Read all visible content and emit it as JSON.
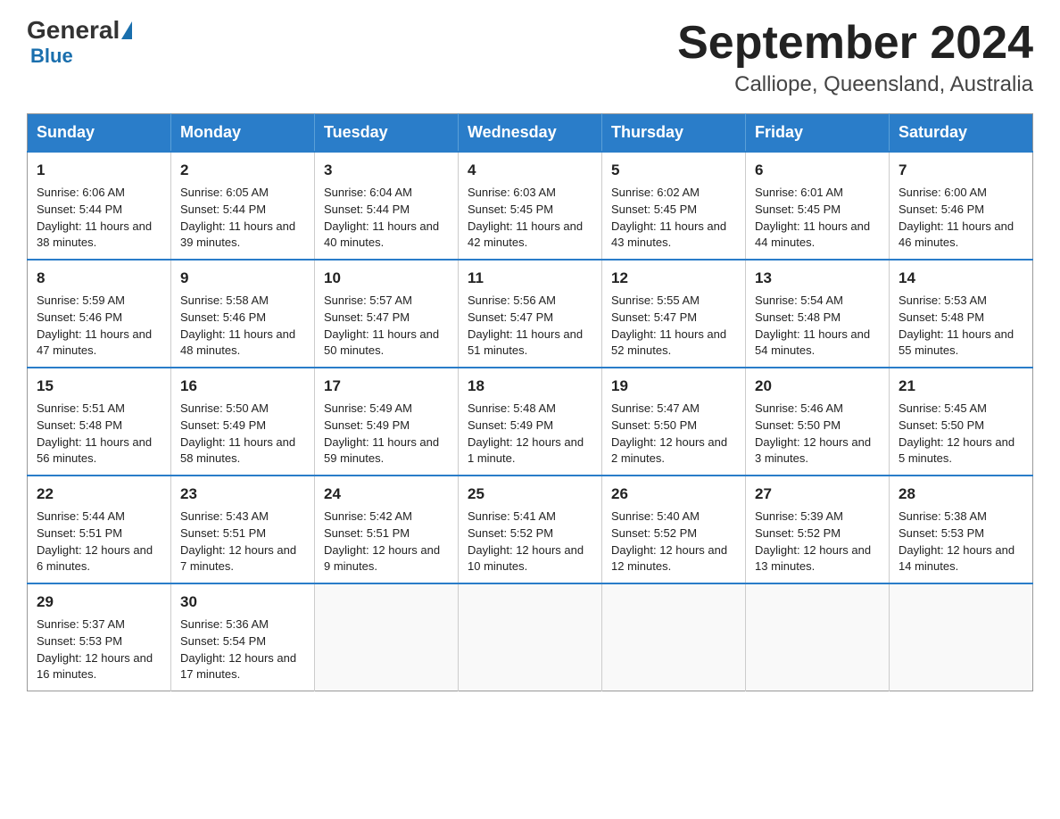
{
  "header": {
    "logo_general": "General",
    "logo_blue": "Blue",
    "month_title": "September 2024",
    "location": "Calliope, Queensland, Australia"
  },
  "weekdays": [
    "Sunday",
    "Monday",
    "Tuesday",
    "Wednesday",
    "Thursday",
    "Friday",
    "Saturday"
  ],
  "weeks": [
    [
      {
        "day": "1",
        "sunrise": "6:06 AM",
        "sunset": "5:44 PM",
        "daylight": "11 hours and 38 minutes."
      },
      {
        "day": "2",
        "sunrise": "6:05 AM",
        "sunset": "5:44 PM",
        "daylight": "11 hours and 39 minutes."
      },
      {
        "day": "3",
        "sunrise": "6:04 AM",
        "sunset": "5:44 PM",
        "daylight": "11 hours and 40 minutes."
      },
      {
        "day": "4",
        "sunrise": "6:03 AM",
        "sunset": "5:45 PM",
        "daylight": "11 hours and 42 minutes."
      },
      {
        "day": "5",
        "sunrise": "6:02 AM",
        "sunset": "5:45 PM",
        "daylight": "11 hours and 43 minutes."
      },
      {
        "day": "6",
        "sunrise": "6:01 AM",
        "sunset": "5:45 PM",
        "daylight": "11 hours and 44 minutes."
      },
      {
        "day": "7",
        "sunrise": "6:00 AM",
        "sunset": "5:46 PM",
        "daylight": "11 hours and 46 minutes."
      }
    ],
    [
      {
        "day": "8",
        "sunrise": "5:59 AM",
        "sunset": "5:46 PM",
        "daylight": "11 hours and 47 minutes."
      },
      {
        "day": "9",
        "sunrise": "5:58 AM",
        "sunset": "5:46 PM",
        "daylight": "11 hours and 48 minutes."
      },
      {
        "day": "10",
        "sunrise": "5:57 AM",
        "sunset": "5:47 PM",
        "daylight": "11 hours and 50 minutes."
      },
      {
        "day": "11",
        "sunrise": "5:56 AM",
        "sunset": "5:47 PM",
        "daylight": "11 hours and 51 minutes."
      },
      {
        "day": "12",
        "sunrise": "5:55 AM",
        "sunset": "5:47 PM",
        "daylight": "11 hours and 52 minutes."
      },
      {
        "day": "13",
        "sunrise": "5:54 AM",
        "sunset": "5:48 PM",
        "daylight": "11 hours and 54 minutes."
      },
      {
        "day": "14",
        "sunrise": "5:53 AM",
        "sunset": "5:48 PM",
        "daylight": "11 hours and 55 minutes."
      }
    ],
    [
      {
        "day": "15",
        "sunrise": "5:51 AM",
        "sunset": "5:48 PM",
        "daylight": "11 hours and 56 minutes."
      },
      {
        "day": "16",
        "sunrise": "5:50 AM",
        "sunset": "5:49 PM",
        "daylight": "11 hours and 58 minutes."
      },
      {
        "day": "17",
        "sunrise": "5:49 AM",
        "sunset": "5:49 PM",
        "daylight": "11 hours and 59 minutes."
      },
      {
        "day": "18",
        "sunrise": "5:48 AM",
        "sunset": "5:49 PM",
        "daylight": "12 hours and 1 minute."
      },
      {
        "day": "19",
        "sunrise": "5:47 AM",
        "sunset": "5:50 PM",
        "daylight": "12 hours and 2 minutes."
      },
      {
        "day": "20",
        "sunrise": "5:46 AM",
        "sunset": "5:50 PM",
        "daylight": "12 hours and 3 minutes."
      },
      {
        "day": "21",
        "sunrise": "5:45 AM",
        "sunset": "5:50 PM",
        "daylight": "12 hours and 5 minutes."
      }
    ],
    [
      {
        "day": "22",
        "sunrise": "5:44 AM",
        "sunset": "5:51 PM",
        "daylight": "12 hours and 6 minutes."
      },
      {
        "day": "23",
        "sunrise": "5:43 AM",
        "sunset": "5:51 PM",
        "daylight": "12 hours and 7 minutes."
      },
      {
        "day": "24",
        "sunrise": "5:42 AM",
        "sunset": "5:51 PM",
        "daylight": "12 hours and 9 minutes."
      },
      {
        "day": "25",
        "sunrise": "5:41 AM",
        "sunset": "5:52 PM",
        "daylight": "12 hours and 10 minutes."
      },
      {
        "day": "26",
        "sunrise": "5:40 AM",
        "sunset": "5:52 PM",
        "daylight": "12 hours and 12 minutes."
      },
      {
        "day": "27",
        "sunrise": "5:39 AM",
        "sunset": "5:52 PM",
        "daylight": "12 hours and 13 minutes."
      },
      {
        "day": "28",
        "sunrise": "5:38 AM",
        "sunset": "5:53 PM",
        "daylight": "12 hours and 14 minutes."
      }
    ],
    [
      {
        "day": "29",
        "sunrise": "5:37 AM",
        "sunset": "5:53 PM",
        "daylight": "12 hours and 16 minutes."
      },
      {
        "day": "30",
        "sunrise": "5:36 AM",
        "sunset": "5:54 PM",
        "daylight": "12 hours and 17 minutes."
      },
      null,
      null,
      null,
      null,
      null
    ]
  ],
  "labels": {
    "sunrise_prefix": "Sunrise: ",
    "sunset_prefix": "Sunset: ",
    "daylight_prefix": "Daylight: "
  }
}
